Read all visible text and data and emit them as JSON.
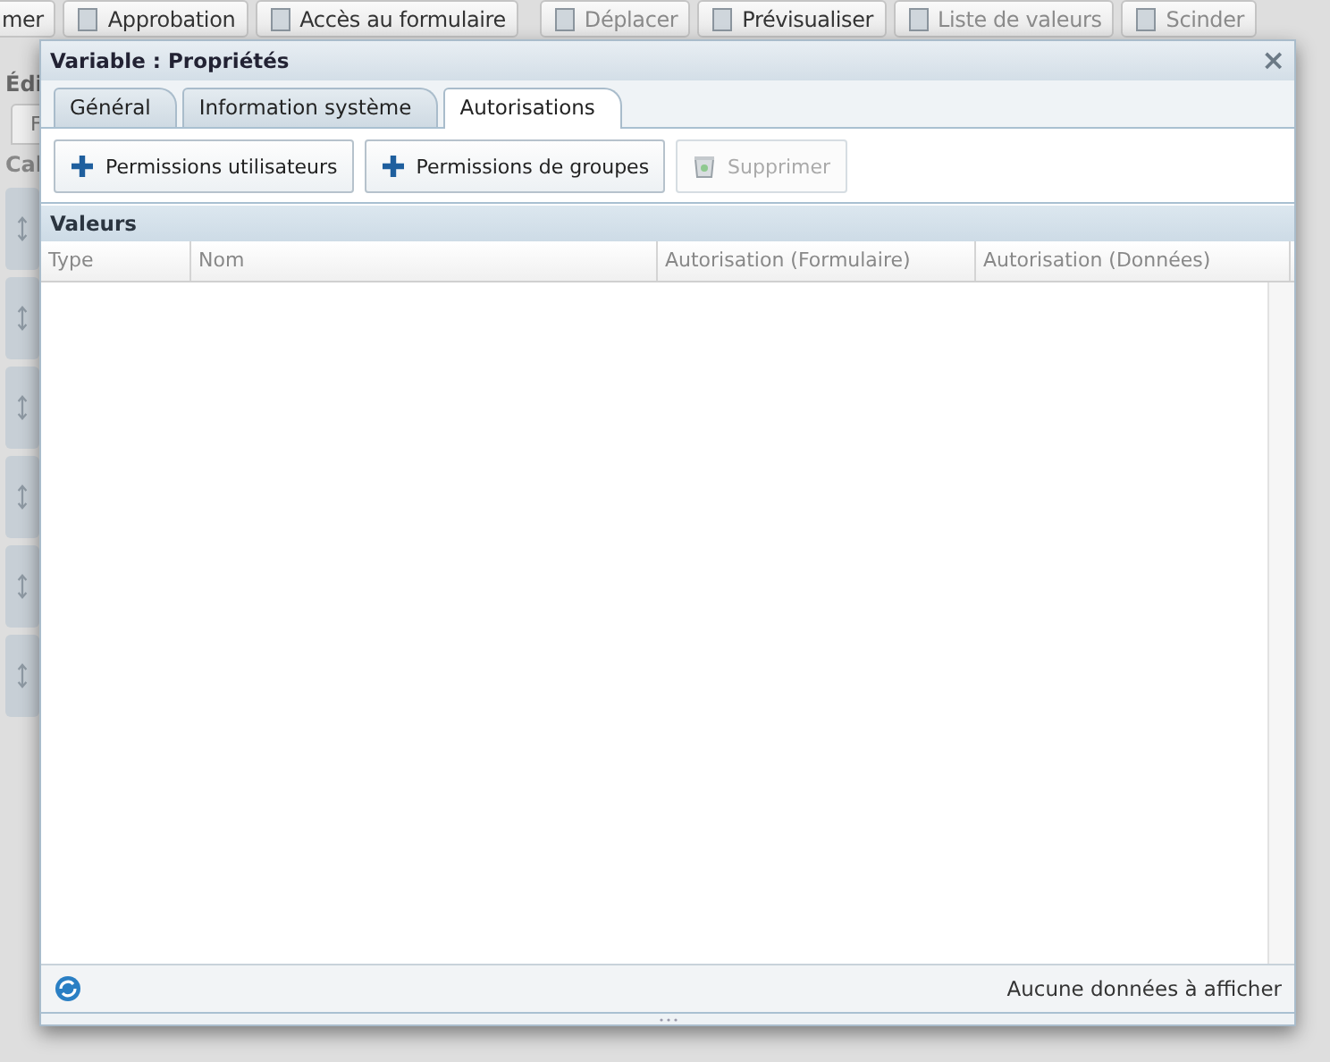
{
  "background": {
    "toolbar": [
      {
        "label": "mer",
        "disabled": false
      },
      {
        "label": "Approbation",
        "disabled": false
      },
      {
        "label": "Accès au formulaire",
        "disabled": false
      },
      {
        "label": "Déplacer",
        "disabled": true
      },
      {
        "label": "Prévisualiser",
        "disabled": false
      },
      {
        "label": "Liste de valeurs",
        "disabled": true
      },
      {
        "label": "Scinder",
        "disabled": true
      }
    ],
    "section_title": "Édi",
    "tab": "F",
    "subtitle": "Cal"
  },
  "window": {
    "title": "Variable : Propriétés",
    "close": "×"
  },
  "tabs": [
    {
      "label": "Général",
      "selected": false
    },
    {
      "label": "Information système",
      "selected": false
    },
    {
      "label": "Autorisations",
      "selected": true
    }
  ],
  "toolbar": [
    {
      "label": "Permissions utilisateurs",
      "kind": "add",
      "disabled": false
    },
    {
      "label": "Permissions de groupes",
      "kind": "add",
      "disabled": false
    },
    {
      "label": "Supprimer",
      "kind": "delete",
      "disabled": true
    }
  ],
  "grid": {
    "title": "Valeurs",
    "columns": [
      "Type",
      "Nom",
      "Autorisation (Formulaire)",
      "Autorisation (Données)"
    ]
  },
  "status_bar": {
    "message": "Aucune données à afficher"
  }
}
